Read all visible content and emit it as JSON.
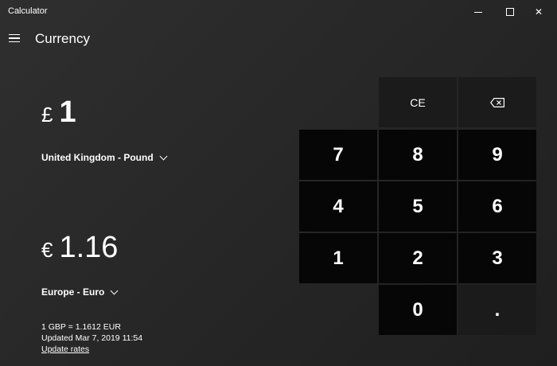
{
  "window": {
    "title": "Calculator",
    "min_glyph": "",
    "max_glyph": "",
    "close_glyph": "✕"
  },
  "header": {
    "mode": "Currency"
  },
  "from": {
    "symbol": "£",
    "value": "1",
    "unit": "United Kingdom - Pound"
  },
  "to": {
    "symbol": "€",
    "value": "1.16",
    "unit": "Europe - Euro"
  },
  "rate": {
    "line1": "1 GBP = 1.1612 EUR",
    "line2": "Updated Mar 7, 2019 11:54",
    "update_link": "Update rates"
  },
  "keypad": {
    "ce": "CE",
    "backspace_icon": "backspace-icon",
    "k7": "7",
    "k8": "8",
    "k9": "9",
    "k4": "4",
    "k5": "5",
    "k6": "6",
    "k1": "1",
    "k2": "2",
    "k3": "3",
    "k0": "0",
    "dot": "."
  }
}
